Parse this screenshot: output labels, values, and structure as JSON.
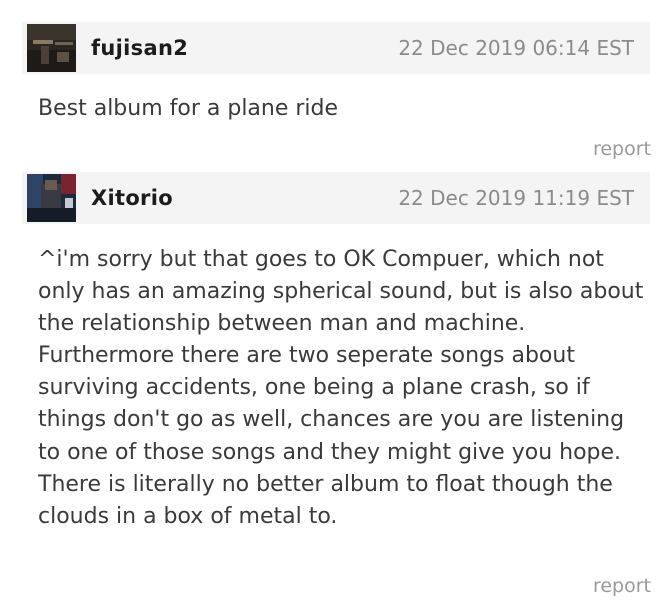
{
  "comments": [
    {
      "username": "fujisan2",
      "timestamp": "22 Dec 2019 06:14 EST",
      "body": "Best album for a plane ride",
      "report_label": "report"
    },
    {
      "username": "Xitorio",
      "timestamp": "22 Dec 2019 11:19 EST",
      "body": "^i'm sorry but that goes to OK Compuer, which not only has an amazing spherical sound, but is also about the relationship between man and machine. Furthermore there are two seperate songs about surviving accidents, one being a plane crash, so if things don't go as well, chances are you are listening to one of those songs and they might give you hope. There is literally no better album to float though the clouds in a box of metal to.",
      "report_label": "report"
    }
  ],
  "colors": {
    "header_bg": "#f4f4f4",
    "username": "#1c1c1c",
    "timestamp": "#8b8b8b",
    "body_text": "#3a3a3a",
    "report": "#9a9a9a"
  }
}
